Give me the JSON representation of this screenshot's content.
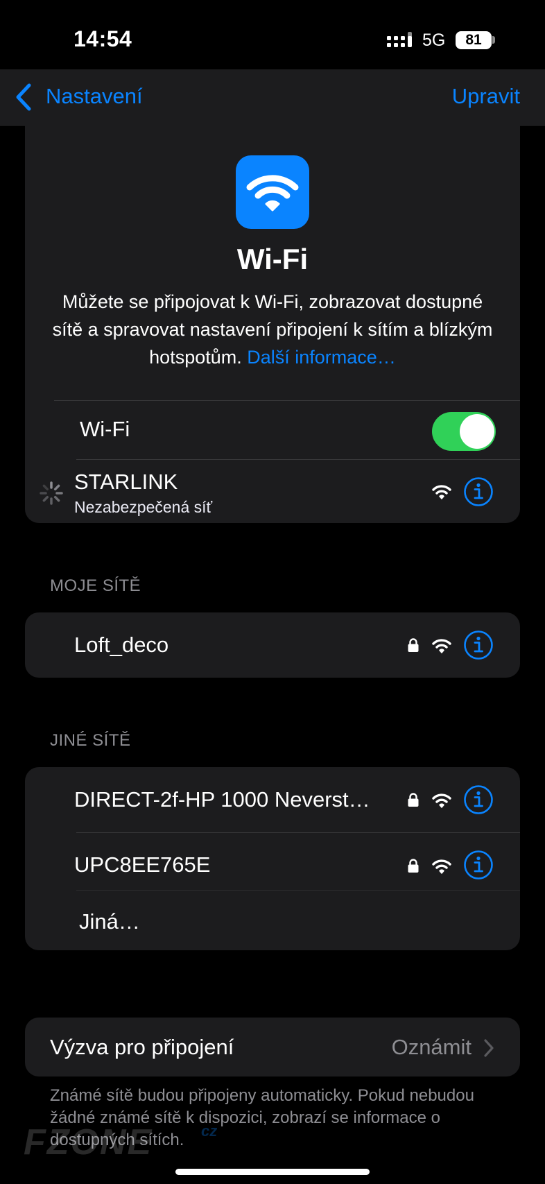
{
  "status_bar": {
    "time": "14:54",
    "network": "5G",
    "battery": "81"
  },
  "nav": {
    "back_label": "Nastavení",
    "edit_label": "Upravit"
  },
  "header": {
    "title": "Wi-Fi",
    "description": "Můžete se připojovat k Wi-Fi, zobrazovat dostupné sítě a spravovat nastavení připojení k sítím a blízkým hotspotům.",
    "learn_more": "Další informace…"
  },
  "wifi_toggle": {
    "label": "Wi-Fi",
    "on": true
  },
  "current_network": {
    "name": "STARLINK",
    "subtitle": "Nezabezpečená síť"
  },
  "my_networks": {
    "header": "MOJE SÍTĚ",
    "items": [
      {
        "name": "Loft_deco",
        "secured": true
      }
    ]
  },
  "other_networks": {
    "header": "JINÉ SÍTĚ",
    "items": [
      {
        "name": "DIRECT-2f-HP 1000 Neverst…",
        "secured": true
      },
      {
        "name": "UPC8EE765E",
        "secured": true
      }
    ],
    "other_label": "Jiná…"
  },
  "ask_to_join": {
    "label": "Výzva pro připojení",
    "value": "Oznámit"
  },
  "footer_text": "Známé sítě budou připojeny automaticky. Pokud nebudou žádné známé sítě k dispozici, zobrazí se informace o dostupných sítích.",
  "watermark": {
    "text": "FZONE",
    "suffix": "cz"
  },
  "colors": {
    "accent": "#0a84ff",
    "toggle_on": "#30d158",
    "background": "#000000",
    "card": "#1c1c1e"
  }
}
